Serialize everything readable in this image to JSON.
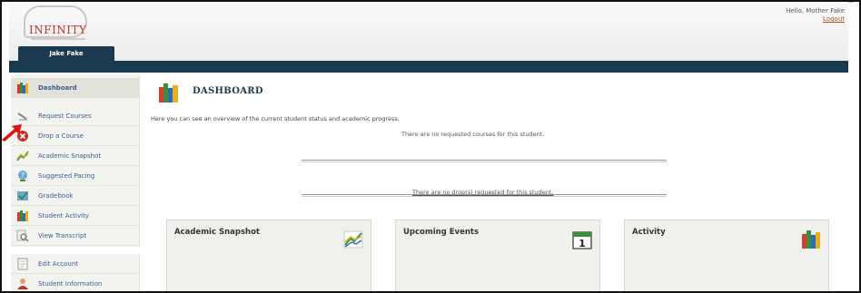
{
  "header": {
    "logo_text": "INFINITY",
    "greeting": "Hello, Mother Fake",
    "logout_label": "Logout",
    "student_tab": "Jake Fake"
  },
  "sidebar": {
    "items": [
      {
        "label": "Dashboard",
        "icon": "books-icon",
        "active": true
      },
      {
        "label": "Request Courses",
        "icon": "stapler-icon"
      },
      {
        "label": "Drop a Course",
        "icon": "remove-circle-icon"
      },
      {
        "label": "Academic Snapshot",
        "icon": "chart-icon"
      },
      {
        "label": "Suggested Pacing",
        "icon": "question-icon"
      },
      {
        "label": "Gradebook",
        "icon": "checkmark-icon"
      },
      {
        "label": "Student Activity",
        "icon": "books-icon"
      },
      {
        "label": "View Transcript",
        "icon": "magnifier-icon"
      },
      {
        "label": "Edit Account",
        "icon": "document-icon"
      },
      {
        "label": "Student Information",
        "icon": "person-icon"
      }
    ]
  },
  "main": {
    "title": "DASHBOARD",
    "overview_text": "Here you can see an overview of the current student status and academic progress.",
    "no_courses_text": "There are no requested courses for this student.",
    "no_drops_text": "There are no drop(s) requested for this student.",
    "widgets": [
      {
        "title": "Academic Snapshot",
        "icon": "chart-icon"
      },
      {
        "title": "Upcoming Events",
        "icon": "calendar-icon",
        "calendar_day": "1"
      },
      {
        "title": "Activity",
        "icon": "books-icon"
      }
    ]
  },
  "colors": {
    "navbar": "#193a4f",
    "link": "#3a5e96",
    "logout": "#c05018",
    "arrow": "#e01010"
  }
}
